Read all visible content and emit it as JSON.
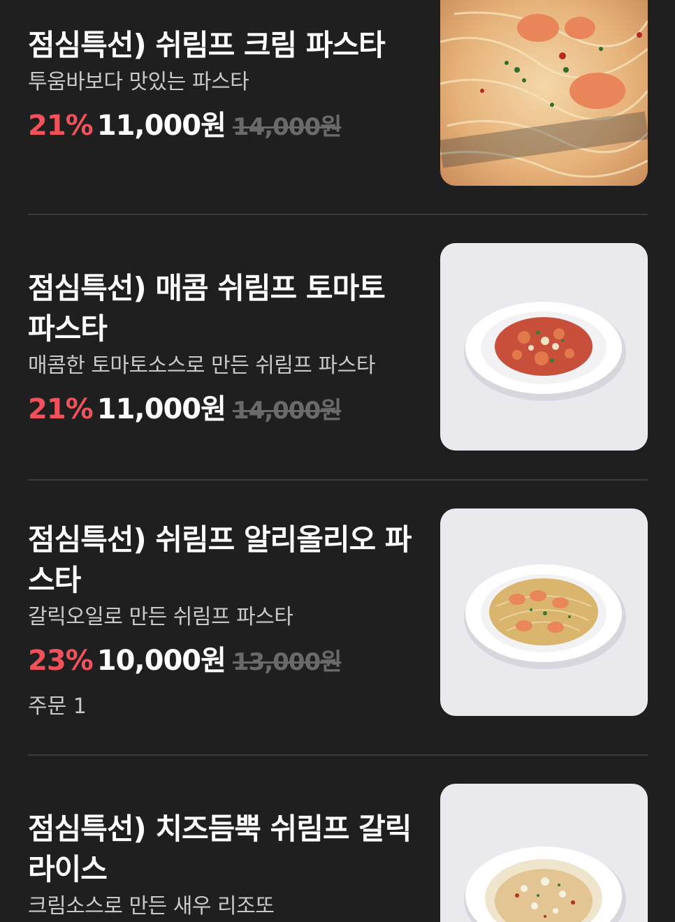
{
  "items": [
    {
      "title": "점심특선) 쉬림프 크림 파스타",
      "desc": "투움바보다 맛있는 파스타",
      "discount": "21%",
      "price": "11,000원",
      "original": "14,000원",
      "image": "cream-pasta-photo"
    },
    {
      "title": "점심특선) 매콤 쉬림프 토마토 파스타",
      "desc": "매콤한 토마토소스로 만든 쉬림프 파스타",
      "discount": "21%",
      "price": "11,000원",
      "original": "14,000원",
      "image": "tomato-pasta-photo"
    },
    {
      "title": "점심특선) 쉬림프 알리올리오 파스타",
      "desc": "갈릭오일로 만든 쉬림프 파스타",
      "discount": "23%",
      "price": "10,000원",
      "original": "13,000원",
      "orders": "주문 1",
      "image": "aglio-olio-photo"
    },
    {
      "title": "점심특선) 치즈듬뿍 쉬림프 갈릭 라이스",
      "desc": "크림소스로 만든 새우 리조또",
      "image": "garlic-rice-photo"
    }
  ]
}
